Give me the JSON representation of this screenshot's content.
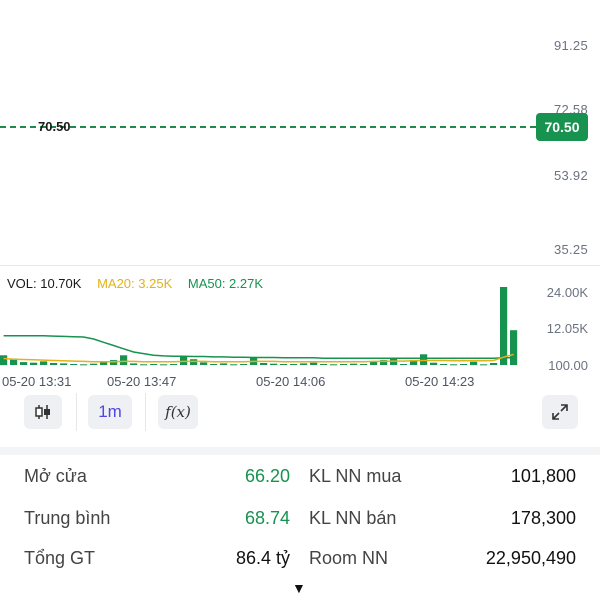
{
  "price_axis": {
    "ticks": [
      "91.25",
      "72.58",
      "53.92",
      "35.25"
    ]
  },
  "price": {
    "current": "70.50",
    "left_label": "70.50",
    "color": "#17924f"
  },
  "volume": {
    "legend": {
      "vol": "VOL: 10.70K",
      "ma20": "MA20: 3.25K",
      "ma50": "MA50: 2.27K"
    },
    "colors": {
      "bar": "#17924f",
      "ma20": "#e2b21a",
      "ma50": "#17924f"
    },
    "axis_ticks": [
      "24.00K",
      "12.05K",
      "100.00"
    ],
    "time_labels": [
      "05-20 13:31",
      "05-20 13:47",
      "05-20 14:06",
      "05-20 14:23"
    ]
  },
  "chart_data": {
    "type": "bar",
    "title": "",
    "ylim": [
      0,
      24000
    ],
    "series": [
      {
        "name": "VOL",
        "values": [
          3000,
          2000,
          900,
          700,
          1100,
          600,
          500,
          300,
          200,
          400,
          900,
          1500,
          3000,
          500,
          200,
          300,
          200,
          300,
          2800,
          1800,
          800,
          300,
          500,
          200,
          300,
          2500,
          600,
          400,
          300,
          300,
          500,
          700,
          300,
          200,
          300,
          400,
          300,
          1200,
          1500,
          2000,
          300,
          1500,
          3300,
          700,
          300,
          200,
          300,
          1000,
          200,
          600,
          24000,
          10700
        ]
      },
      {
        "name": "MA20",
        "values": [
          2000,
          1800,
          1700,
          1600,
          1500,
          1400,
          1300,
          1200,
          1100,
          1000,
          1000,
          1000,
          1100,
          1100,
          1000,
          1000,
          1000,
          1000,
          1100,
          1100,
          1100,
          1000,
          1000,
          1000,
          1000,
          1100,
          1100,
          1100,
          1000,
          1000,
          1000,
          1000,
          1000,
          1000,
          1000,
          1000,
          1000,
          1100,
          1100,
          1200,
          1200,
          1300,
          1400,
          1400,
          1400,
          1300,
          1300,
          1300,
          1300,
          1400,
          2400,
          3250
        ]
      },
      {
        "name": "MA50",
        "values": [
          9000,
          9000,
          9000,
          9000,
          9000,
          8900,
          8800,
          8700,
          8600,
          8000,
          7000,
          6000,
          5000,
          4000,
          3500,
          3000,
          2800,
          2700,
          2700,
          2600,
          2600,
          2500,
          2500,
          2400,
          2400,
          2300,
          2300,
          2300,
          2200,
          2200,
          2200,
          2200,
          2100,
          2100,
          2100,
          2100,
          2100,
          2100,
          2100,
          2100,
          2100,
          2100,
          2100,
          2100,
          2100,
          2100,
          2100,
          2100,
          2100,
          2100,
          2200,
          2270
        ]
      }
    ]
  },
  "toolbar": {
    "candle_icon": "candlestick-icon",
    "interval": "1m",
    "function_label": "f(x)",
    "expand_icon": "expand-icon"
  },
  "stats": {
    "open_label": "Mở cửa",
    "open_value": "66.20",
    "avg_label": "Trung bình",
    "avg_value": "68.74",
    "total_label": "Tổng GT",
    "total_value": "86.4 tỷ",
    "buy_label": "KL NN mua",
    "buy_value": "101,800",
    "sell_label": "KL NN bán",
    "sell_value": "178,300",
    "room_label": "Room NN",
    "room_value": "22,950,490"
  },
  "more_indicator": "▼"
}
